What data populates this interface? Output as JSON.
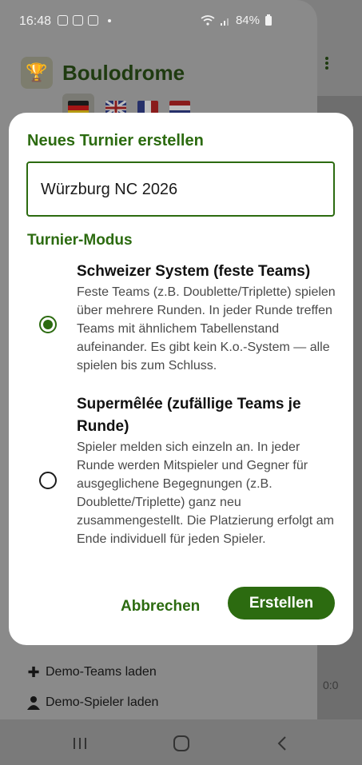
{
  "status_bar": {
    "time": "16:48",
    "battery": "84%"
  },
  "app": {
    "title": "Boulodrome",
    "background_actions": [
      {
        "label": "Demo-Teams laden",
        "icon": "plus-icon"
      },
      {
        "label": "Demo-Spieler laden",
        "icon": "person-icon"
      }
    ],
    "score_fragment": "0:0"
  },
  "dialog": {
    "title": "Neues Turnier erstellen",
    "name_value": "Würzburg NC 2026",
    "mode_heading": "Turnier-Modus",
    "options": [
      {
        "title": "Schweizer System (feste Teams)",
        "description": "Feste Teams (z.B. Doublette/Triplette) spielen über mehrere Runden. In jeder Runde treffen Teams mit ähnlichem Tabellenstand aufeinander. Es gibt kein K.o.-System — alle spielen bis zum Schluss.",
        "selected": true
      },
      {
        "title": "Supermêlée (zufällige Teams je Runde)",
        "description": "Spieler melden sich einzeln an. In jeder Runde werden Mitspieler und Gegner für ausgeglichene Begegnungen (z.B. Doublette/Triplette) ganz neu zusammengestellt. Die Platzierung erfolgt am Ende individuell für jeden Spieler.",
        "selected": false
      }
    ],
    "cancel_label": "Abbrechen",
    "create_label": "Erstellen"
  },
  "colors": {
    "primary": "#2c6b10",
    "scrim": "#7f7f7f"
  }
}
